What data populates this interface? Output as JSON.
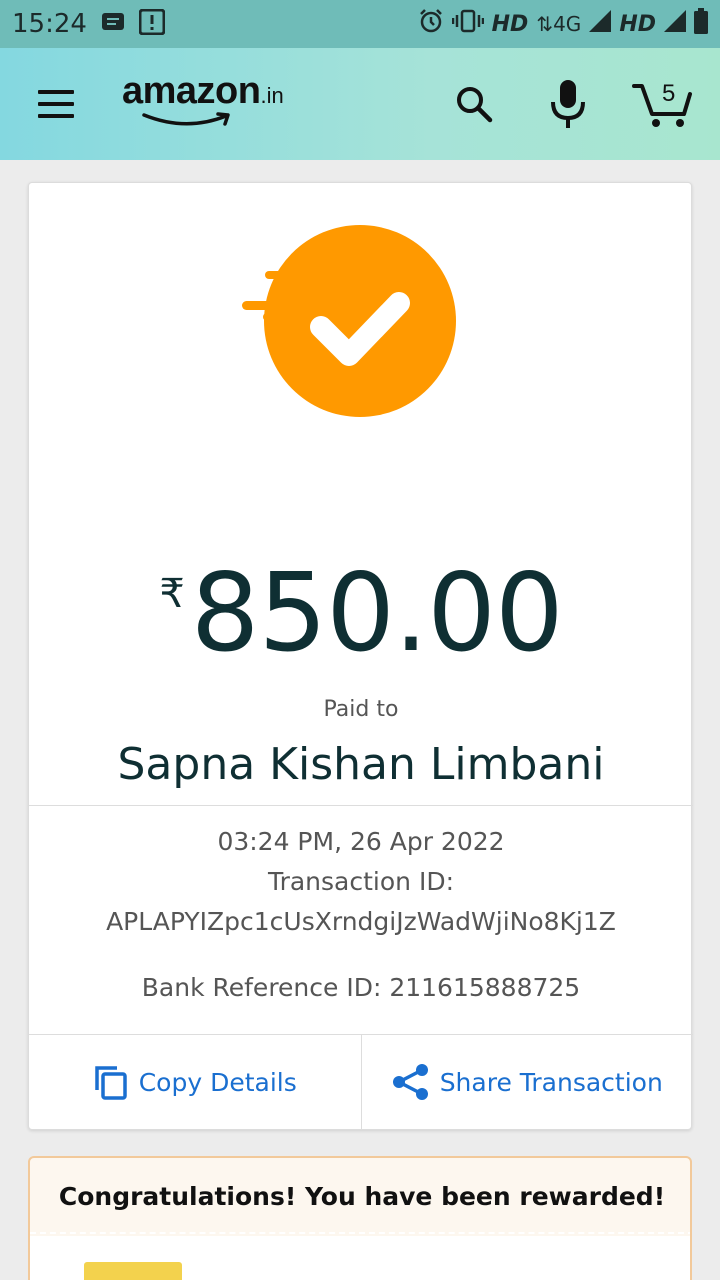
{
  "status_bar": {
    "time": "15:24",
    "net1": "HD",
    "net_type": "4G",
    "net2": "HD"
  },
  "header": {
    "logo_text": "amazon",
    "logo_tld": ".in",
    "cart_count": "5"
  },
  "payment": {
    "currency_symbol": "₹",
    "amount": "850.00",
    "paid_to_label": "Paid to",
    "payee_name": "Sapna Kishan Limbani",
    "datetime": "03:24 PM, 26 Apr 2022",
    "transaction_id_label": "Transaction ID:",
    "transaction_id": "APLAPYIZpc1cUsXrndgiJzWadWjiNo8Kj1Z",
    "bank_reference": "Bank Reference ID: 211615888725",
    "status_color": "#ff9900"
  },
  "actions": {
    "copy_label": "Copy Details",
    "share_label": "Share Transaction"
  },
  "reward": {
    "title": "Congratulations! You have been rewarded!"
  },
  "colors": {
    "link": "#1a6fd0",
    "amount_text": "#0f2f33"
  }
}
